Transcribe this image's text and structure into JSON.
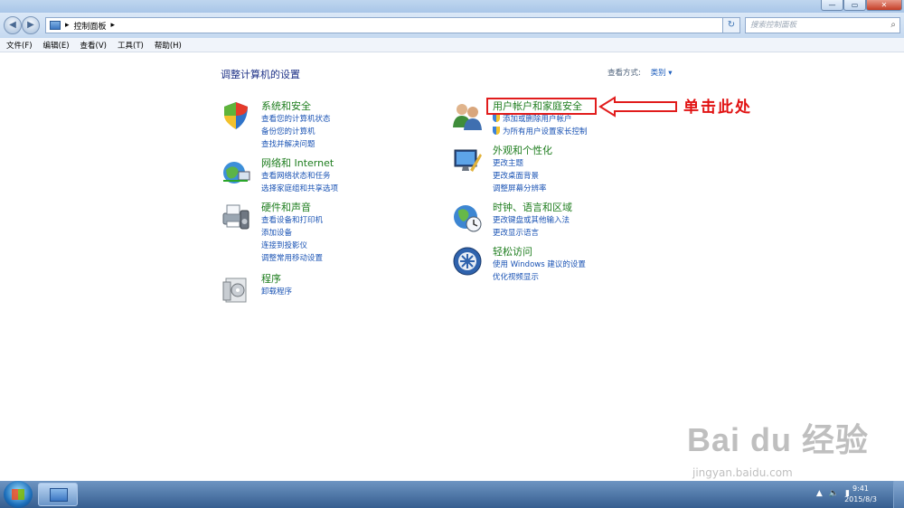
{
  "address": {
    "crumb_sep": "▸",
    "path": "控制面板",
    "path_sep": "▸"
  },
  "search": {
    "placeholder": "搜索控制面板"
  },
  "menu": [
    "文件(F)",
    "编辑(E)",
    "查看(V)",
    "工具(T)",
    "帮助(H)"
  ],
  "content": {
    "title": "调整计算机的设置",
    "view_by_label": "查看方式:",
    "view_by_value": "类别 ▾",
    "left": [
      {
        "head": "系统和安全",
        "links": [
          "查看您的计算机状态",
          "备份您的计算机",
          "查找并解决问题"
        ]
      },
      {
        "head": "网络和 Internet",
        "links": [
          "查看网络状态和任务",
          "选择家庭组和共享选项"
        ]
      },
      {
        "head": "硬件和声音",
        "links": [
          "查看设备和打印机",
          "添加设备",
          "连接到投影仪",
          "调整常用移动设置"
        ]
      },
      {
        "head": "程序",
        "links": [
          "卸载程序"
        ]
      }
    ],
    "right": [
      {
        "head": "用户帐户和家庭安全",
        "links": [
          "添加或删除用户帐户",
          "为所有用户设置家长控制"
        ]
      },
      {
        "head": "外观和个性化",
        "links": [
          "更改主题",
          "更改桌面背景",
          "调整屏幕分辨率"
        ]
      },
      {
        "head": "时钟、语言和区域",
        "links": [
          "更改键盘或其他输入法",
          "更改显示语言"
        ]
      },
      {
        "head": "轻松访问",
        "links": [
          "使用 Windows 建议的设置",
          "优化视频显示"
        ]
      }
    ],
    "annotation": "单击此处"
  },
  "watermark": {
    "main": "Bai du 经验",
    "sub": "jingyan.baidu.com"
  },
  "taskbar": {
    "time": "9:41",
    "date": "2015/8/3"
  },
  "colors": {
    "heading_green": "#1e7d1e",
    "link_blue": "#1a53b4",
    "annotation_red": "#e11212"
  }
}
